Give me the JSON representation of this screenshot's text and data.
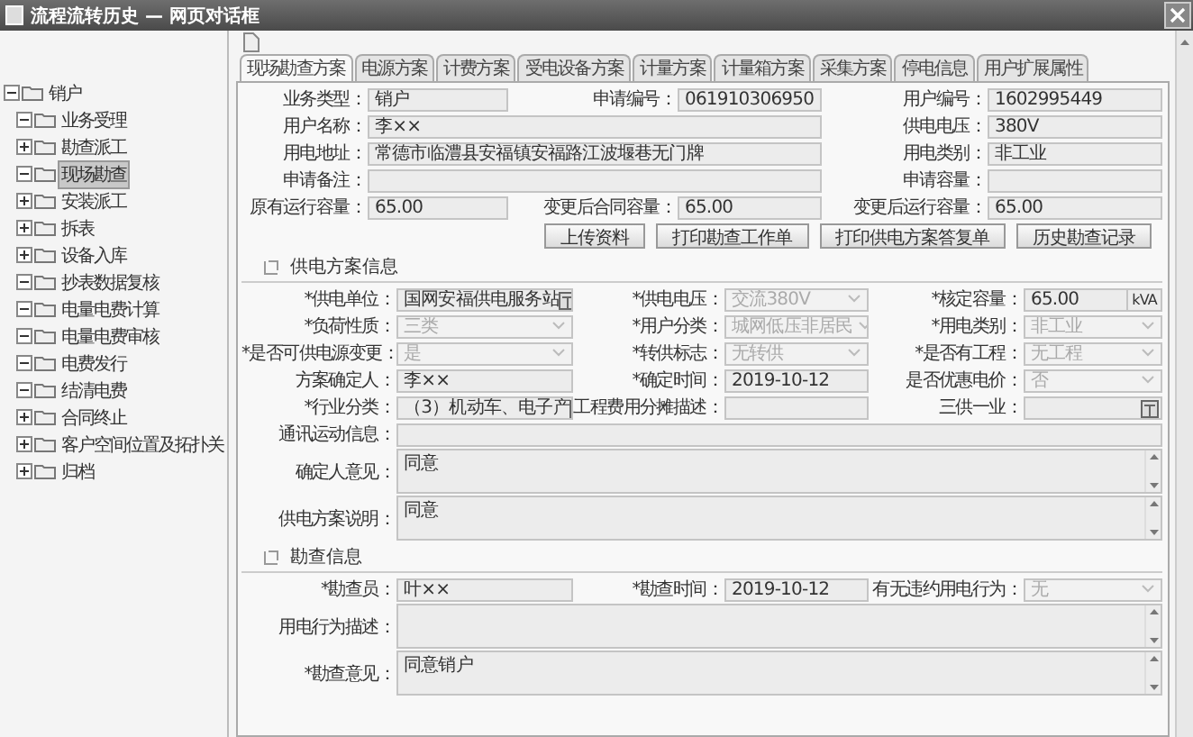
{
  "window": {
    "title": "流程流转历史 — 网页对话框"
  },
  "tree": {
    "label": "销户",
    "expanded": true,
    "children": [
      {
        "label": "业务受理",
        "expanded": true,
        "selected": false
      },
      {
        "label": "勘查派工",
        "expanded": false,
        "selected": false
      },
      {
        "label": "现场勘查",
        "expanded": true,
        "selected": true
      },
      {
        "label": "安装派工",
        "expanded": false,
        "selected": false
      },
      {
        "label": "拆表",
        "expanded": false,
        "selected": false
      },
      {
        "label": "设备入库",
        "expanded": false,
        "selected": false
      },
      {
        "label": "抄表数据复核",
        "expanded": true,
        "selected": false
      },
      {
        "label": "电量电费计算",
        "expanded": true,
        "selected": false
      },
      {
        "label": "电量电费审核",
        "expanded": true,
        "selected": false
      },
      {
        "label": "电费发行",
        "expanded": true,
        "selected": false
      },
      {
        "label": "结清电费",
        "expanded": true,
        "selected": false
      },
      {
        "label": "合同终止",
        "expanded": false,
        "selected": false
      },
      {
        "label": "客户空间位置及拓扑关",
        "expanded": false,
        "selected": false
      },
      {
        "label": "归档",
        "expanded": false,
        "selected": false
      }
    ]
  },
  "tabs": [
    {
      "label": "现场勘查方案",
      "selected": true
    },
    {
      "label": "电源方案",
      "selected": false
    },
    {
      "label": "计费方案",
      "selected": false
    },
    {
      "label": "受电设备方案",
      "selected": false
    },
    {
      "label": "计量方案",
      "selected": false
    },
    {
      "label": "计量箱方案",
      "selected": false
    },
    {
      "label": "采集方案",
      "selected": false
    },
    {
      "label": "停电信息",
      "selected": false
    },
    {
      "label": "用户扩展属性",
      "selected": false
    }
  ],
  "basic_rows": [
    [
      {
        "label": "业务类型：",
        "value": "销户",
        "kind": "text"
      },
      {
        "label": "申请编号：",
        "value": "061910306950",
        "kind": "text"
      },
      {
        "label": "用户编号：",
        "value": "1602995449",
        "kind": "text"
      }
    ],
    [
      {
        "label": "用户名称：",
        "value": "李××",
        "kind": "text"
      },
      {
        "label": "供电电压：",
        "value": "380V",
        "kind": "text"
      }
    ],
    [
      {
        "label": "用电地址：",
        "value": "常德市临澧县安福镇安福路江波堰巷无门牌",
        "kind": "text"
      },
      {
        "label": "用电类别：",
        "value": "非工业",
        "kind": "text"
      }
    ],
    [
      {
        "label": "申请备注：",
        "kind": "text"
      },
      {
        "label": "申请容量：",
        "kind": "text"
      }
    ],
    [
      {
        "label": "原有运行容量：",
        "value": "65.00",
        "kind": "text"
      },
      {
        "label": "变更后合同容量：",
        "value": "65.00",
        "kind": "text"
      },
      {
        "label": "变更后运行容量：",
        "value": "65.00",
        "kind": "text"
      }
    ]
  ],
  "buttons": [
    "上传资料",
    "打印勘查工作单",
    "打印供电方案答复单",
    "历史勘查记录"
  ],
  "sections": [
    {
      "title": "供电方案信息",
      "rows": [
        [
          {
            "label": "*供电单位：",
            "value": "国网安福供电服务站",
            "kind": "picker"
          },
          {
            "label": "*供电电压：",
            "value": "交流380V",
            "kind": "select",
            "disabled": true
          },
          {
            "label": "*核定容量：",
            "value": "65.00",
            "unit": "kVA",
            "kind": "unit"
          }
        ],
        [
          {
            "label": "*负荷性质：",
            "value": "三类",
            "kind": "select",
            "disabled": true
          },
          {
            "label": "*用户分类：",
            "value": "城网低压非居民",
            "kind": "select",
            "disabled": true
          },
          {
            "label": "*用电类别：",
            "value": "非工业",
            "kind": "select",
            "disabled": true
          }
        ],
        [
          {
            "label": "*是否可供电源变更：",
            "value": "是",
            "kind": "select",
            "disabled": true
          },
          {
            "label": "*转供标志：",
            "value": "无转供",
            "kind": "select",
            "disabled": true
          },
          {
            "label": "*是否有工程：",
            "value": "无工程",
            "kind": "select",
            "disabled": true
          }
        ],
        [
          {
            "label": "方案确定人：",
            "value": "李××",
            "kind": "text"
          },
          {
            "label": "*确定时间：",
            "value": "2019-10-12",
            "kind": "text"
          },
          {
            "label": "是否优惠电价：",
            "value": "否",
            "kind": "select",
            "disabled": true
          }
        ],
        [
          {
            "label": "*行业分类：",
            "value": "（3）机动车、电子产",
            "kind": "picker"
          },
          {
            "label": "工程费用分摊描述：",
            "kind": "text"
          },
          {
            "label": "三供一业：",
            "kind": "picker"
          }
        ],
        [
          {
            "label": "通讯运动信息：",
            "kind": "text"
          }
        ],
        [
          {
            "label": "确定人意见：",
            "value": "同意",
            "kind": "textarea"
          }
        ],
        [
          {
            "label": "供电方案说明：",
            "value": "同意",
            "kind": "textarea"
          }
        ]
      ]
    },
    {
      "title": "勘查信息",
      "rows": [
        [
          {
            "label": "*勘查员：",
            "value": "叶××",
            "kind": "text"
          },
          {
            "label": "*勘查时间：",
            "value": "2019-10-12",
            "kind": "text"
          },
          {
            "label": "有无违约用电行为：",
            "value": "无",
            "kind": "select",
            "disabled": true
          }
        ],
        [
          {
            "label": "用电行为描述：",
            "kind": "textarea"
          }
        ],
        [
          {
            "label": "*勘查意见：",
            "value": "同意销户",
            "kind": "textarea"
          }
        ]
      ]
    }
  ]
}
